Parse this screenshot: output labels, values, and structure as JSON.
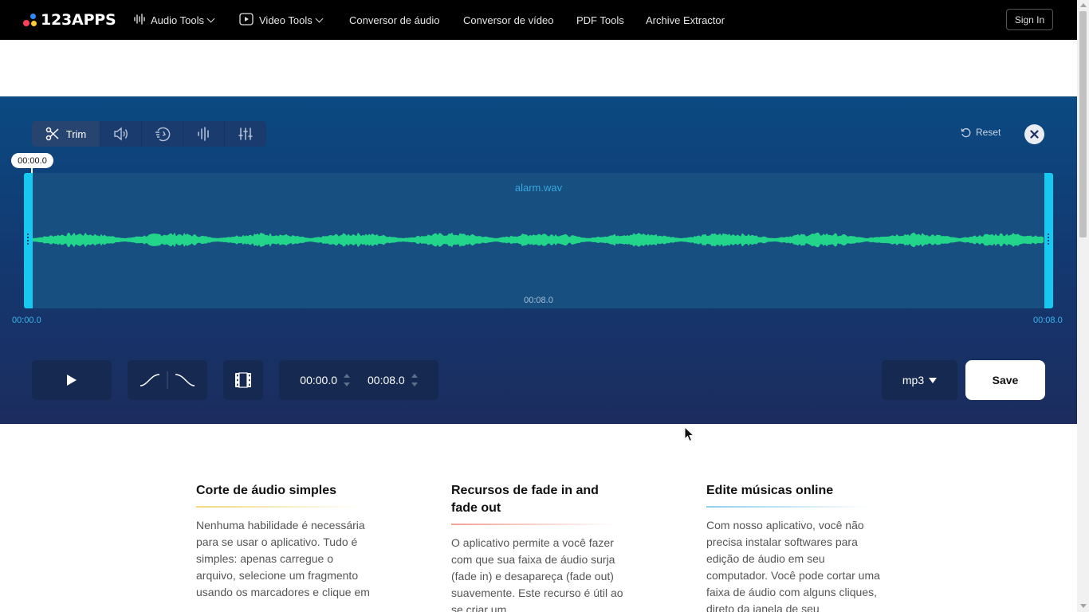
{
  "nav": {
    "logo": "123APPS",
    "audio_tools": "Audio Tools",
    "video_tools": "Video Tools",
    "audio_converter": "Conversor de áudio",
    "video_converter": "Conversor de vídeo",
    "pdf_tools": "PDF Tools",
    "archive_extractor": "Archive Extractor",
    "sign_in": "Sign In"
  },
  "editor": {
    "tabs": [
      {
        "label": "Trim",
        "icon": "scissors-icon"
      },
      {
        "icon": "volume-icon"
      },
      {
        "icon": "speed-icon"
      },
      {
        "icon": "waveform-icon"
      },
      {
        "icon": "equalizer-icon"
      }
    ],
    "reset_label": "Reset",
    "playhead_time": "00:00.0",
    "filename": "alarm.wav",
    "mid_time": "00:08.0",
    "start_time": "00:00.0",
    "end_time": "00:08.0",
    "trim_start": "00:00.0",
    "trim_end": "00:08.0",
    "format": "mp3",
    "save_label": "Save",
    "waveform_color": "#23d58a",
    "handle_color": "#17c8f0"
  },
  "features": [
    {
      "title": "Corte de áudio simples",
      "accent": "#f2d97a",
      "text": "Nenhuma habilidade é necessária para se usar o aplicativo. Tudo é simples: apenas carregue o arquivo, selecione um fragmento usando os marcadores e clique em"
    },
    {
      "title": "Recursos de fade in and fade out",
      "accent": "#f3a193",
      "text": "O aplicativo permite a você fazer com que sua faixa de áudio surja (fade in) e desapareça (fade out) suavemente. Este recurso é útil ao se criar um"
    },
    {
      "title": "Edite músicas online",
      "accent": "#8fd0f0",
      "text": "Com nosso aplicativo, você não precisa instalar softwares para edição de áudio em seu computador. Você pode cortar uma faixa de áudio com alguns cliques, direto da janela de seu"
    }
  ]
}
